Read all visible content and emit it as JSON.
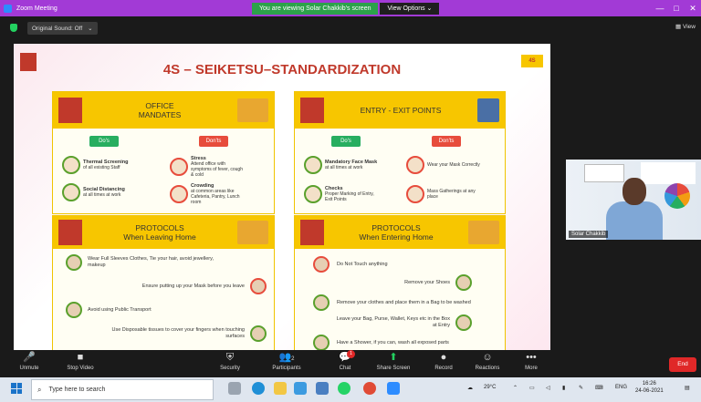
{
  "window": {
    "title": "Zoom Meeting",
    "minimize": "—",
    "maximize": "□",
    "close": "✕"
  },
  "banner": {
    "message": "You are viewing Solar Chakkib's screen",
    "view_options": "View Options ⌄"
  },
  "subbar": {
    "original_sound": "Original Sound: Off",
    "dropdown": "⌄",
    "view_label": "View"
  },
  "slide": {
    "title": "4S – SEIKETSU–STANDARDIZATION",
    "corner_badge": "4S",
    "left_top": {
      "heading": "OFFICE\nMANDATES",
      "dos_tag": "Do's",
      "donts_tag": "Don'ts",
      "dos": [
        {
          "title": "Thermal Screening",
          "desc": "of all existing Staff"
        },
        {
          "title": "Social Distancing",
          "desc": "at all times at work"
        }
      ],
      "donts": [
        {
          "title": "Stress",
          "desc": "Attend office with symptoms of fever, cough & cold"
        },
        {
          "title": "Crowding",
          "desc": "at common areas like Cafeteria, Pantry, Lunch room"
        }
      ]
    },
    "right_top": {
      "heading": "ENTRY - EXIT POINTS",
      "dos_tag": "Do's",
      "donts_tag": "Don'ts",
      "dos": [
        {
          "title": "Mandatory Face Mask",
          "desc": "at all times at work"
        },
        {
          "title": "Checks",
          "desc": "Proper Marking of Entry, Exit Points"
        }
      ],
      "donts": [
        {
          "title": "",
          "desc": "Wear your Mask Correctly"
        },
        {
          "title": "",
          "desc": "Mass Gatherings at any place"
        }
      ]
    },
    "left_bottom": {
      "heading": "PROTOCOLS\nWhen Leaving Home",
      "rows": [
        "Wear Full Sleeves Clothes, Tie your hair, avoid jewellery, makeup",
        "Ensure putting up your Mask before you leave",
        "Avoid using Public Transport",
        "Use Disposable tissues to cover your fingers when touching surfaces"
      ]
    },
    "right_bottom": {
      "heading": "PROTOCOLS\nWhen Entering Home",
      "rows": [
        "Do Not Touch anything",
        "Remove your Shoes",
        "Remove your clothes and place them in a Bag to be washed",
        "Leave your Bag, Purse, Wallet, Keys etc in the Box at Entry",
        "Have a Shower, if you can, wash all exposed parts"
      ]
    }
  },
  "participant": {
    "name": "Solar Chakkib"
  },
  "toolbar": {
    "unmute": "Unmute",
    "stop_video": "Stop Video",
    "security": "Security",
    "participants": "Participants",
    "participants_count": "2",
    "chat": "Chat",
    "chat_badge": "1",
    "share_screen": "Share Screen",
    "record": "Record",
    "reactions": "Reactions",
    "more": "More",
    "end": "End"
  },
  "taskbar": {
    "search_placeholder": "Type here to search",
    "weather": "29°C",
    "lang": "ENG",
    "time": "16:26",
    "date": "24-06-2021"
  }
}
